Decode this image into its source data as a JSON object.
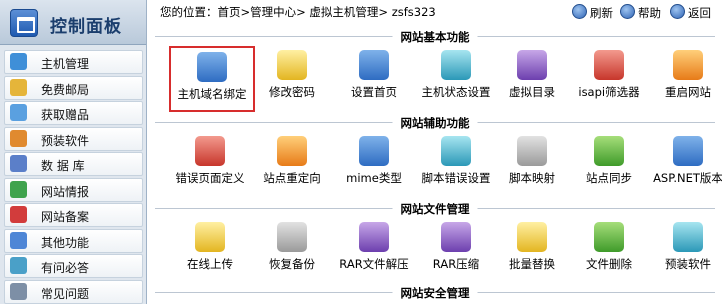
{
  "sidebar": {
    "title": "控制面板",
    "items": [
      {
        "label": "主机管理",
        "icon": "server-icon",
        "color": "#3f8fd8"
      },
      {
        "label": "免费邮局",
        "icon": "mail-icon",
        "color": "#e5b53a"
      },
      {
        "label": "获取赠品",
        "icon": "gift-icon",
        "color": "#5aa0e0"
      },
      {
        "label": "预装软件",
        "icon": "software-icon",
        "color": "#e08a2f"
      },
      {
        "label": "数 据 库",
        "icon": "database-icon",
        "color": "#5b7fc9"
      },
      {
        "label": "网站情报",
        "icon": "globe-icon",
        "color": "#3fa34d"
      },
      {
        "label": "网站备案",
        "icon": "record-icon",
        "color": "#d23c3c"
      },
      {
        "label": "其他功能",
        "icon": "folder-icon",
        "color": "#4e86d6"
      },
      {
        "label": "有问必答",
        "icon": "qa-icon",
        "color": "#4aa0c8"
      },
      {
        "label": "常见问题",
        "icon": "faq-icon",
        "color": "#7d8fa6"
      }
    ]
  },
  "topbar": {
    "breadcrumb": "您的位置：首页>管理中心> 虚拟主机管理> zsfs323",
    "refresh": "刷新",
    "help": "帮助",
    "back": "返回"
  },
  "sections": [
    {
      "title": "网站基本功能",
      "items": [
        {
          "label": "主机域名绑定",
          "icon": "domain-bind-icon",
          "color": "blue",
          "selected": true
        },
        {
          "label": "修改密码",
          "icon": "lock-icon",
          "color": "yellow"
        },
        {
          "label": "设置首页",
          "icon": "homepage-icon",
          "color": "blue"
        },
        {
          "label": "主机状态设置",
          "icon": "gear-icon",
          "color": "cyan"
        },
        {
          "label": "虚拟目录",
          "icon": "clock-icon",
          "color": "purple"
        },
        {
          "label": "isapi筛选器",
          "icon": "tools-icon",
          "color": "red"
        },
        {
          "label": "重启网站",
          "icon": "restart-icon",
          "color": "orange"
        }
      ]
    },
    {
      "title": "网站辅助功能",
      "items": [
        {
          "label": "错误页面定义",
          "icon": "error-page-icon",
          "color": "red"
        },
        {
          "label": "站点重定向",
          "icon": "redirect-icon",
          "color": "orange"
        },
        {
          "label": "mime类型",
          "icon": "mime-icon",
          "color": "blue"
        },
        {
          "label": "脚本错误设置",
          "icon": "script-error-icon",
          "color": "cyan"
        },
        {
          "label": "脚本映射",
          "icon": "script-map-icon",
          "color": "gray"
        },
        {
          "label": "站点同步",
          "icon": "sync-icon",
          "color": "green"
        },
        {
          "label": "ASP.NET版本",
          "icon": "aspnet-icon",
          "color": "blue"
        }
      ]
    },
    {
      "title": "网站文件管理",
      "items": [
        {
          "label": "在线上传",
          "icon": "upload-icon",
          "color": "yellow"
        },
        {
          "label": "恢复备份",
          "icon": "restore-icon",
          "color": "gray"
        },
        {
          "label": "RAR文件解压",
          "icon": "rar-extract-icon",
          "color": "purple"
        },
        {
          "label": "RAR压缩",
          "icon": "rar-compress-icon",
          "color": "purple"
        },
        {
          "label": "批量替换",
          "icon": "replace-icon",
          "color": "yellow"
        },
        {
          "label": "文件删除",
          "icon": "delete-icon",
          "color": "green"
        },
        {
          "label": "预装软件",
          "icon": "cd-icon",
          "color": "cyan"
        }
      ]
    },
    {
      "title": "网站安全管理",
      "items": []
    }
  ]
}
